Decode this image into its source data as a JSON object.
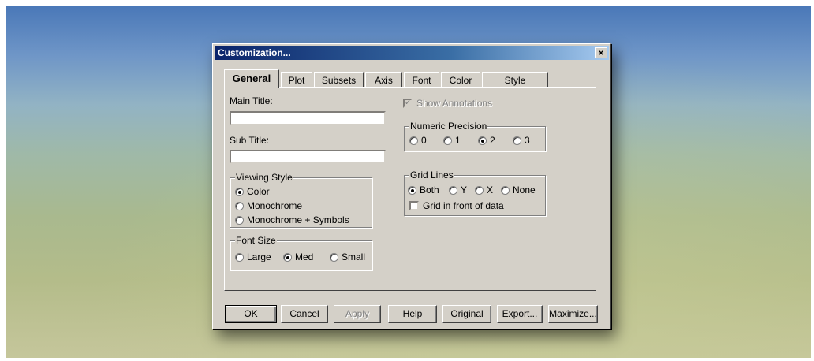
{
  "window": {
    "title": "Customization..."
  },
  "tabs": [
    "General",
    "Plot",
    "Subsets",
    "Axis",
    "Font",
    "Color",
    "Style"
  ],
  "general": {
    "main_title_label": "Main Title:",
    "main_title_value": "",
    "sub_title_label": "Sub Title:",
    "sub_title_value": "",
    "viewing_style": {
      "label": "Viewing Style",
      "options": [
        "Color",
        "Monochrome",
        "Monochrome + Symbols"
      ],
      "selected": "Color"
    },
    "font_size": {
      "label": "Font Size",
      "options": [
        "Large",
        "Med",
        "Small"
      ],
      "selected": "Med"
    },
    "show_annotations": {
      "label": "Show Annotations",
      "checked": true,
      "enabled": false
    },
    "numeric_precision": {
      "label": "Numeric Precision",
      "options": [
        "0",
        "1",
        "2",
        "3"
      ],
      "selected": "2"
    },
    "grid_lines": {
      "label": "Grid Lines",
      "options": [
        "Both",
        "Y",
        "X",
        "None"
      ],
      "selected": "Both",
      "front_label": "Grid in front of data",
      "front_checked": false
    }
  },
  "buttons": {
    "ok": "OK",
    "cancel": "Cancel",
    "apply": "Apply",
    "help": "Help",
    "original": "Original",
    "export": "Export...",
    "maximize": "Maximize..."
  }
}
